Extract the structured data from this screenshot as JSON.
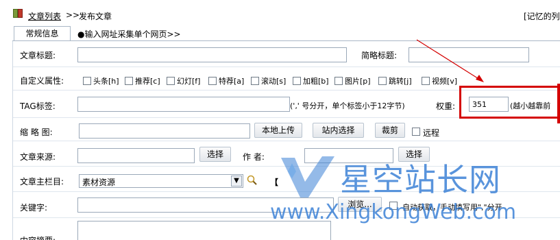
{
  "header": {
    "breadcrumb_link": "文章列表",
    "breadcrumb_sep": ">>",
    "breadcrumb_current": "发布文章",
    "remember": "[记忆的列"
  },
  "tabs": {
    "active": "常规信息",
    "other": "●输入网址采集单个网页>>"
  },
  "form": {
    "title_label": "文章标题:",
    "short_title_label": "简略标题:",
    "custom_attr_label": "自定义属性:",
    "attributes": [
      "头条[h]",
      "推荐[c]",
      "幻灯[f]",
      "特荐[a]",
      "滚动[s]",
      "加粗[b]",
      "图片[p]",
      "跳转[j]",
      "视频[v]"
    ],
    "tag_label": "TAG标签:",
    "tag_hint": "(',' 号分开，单个标签小于12字节)",
    "weight_label": "权重:",
    "weight_value": "351",
    "weight_hint": "(越小越靠前",
    "thumb_label": "缩 略 图:",
    "upload_button": "本地上传",
    "site_select_button": "站内选择",
    "crop_button": "裁剪",
    "remote_label": "远程",
    "source_label": "文章来源:",
    "select_button": "选择",
    "author_label": "作  者:",
    "author_select_button": "选择",
    "column_label": "文章主栏目:",
    "column_value": "素材资源",
    "column_extra": "【",
    "keywords_label": "关键字:",
    "browse_button": "浏览...",
    "auto_fetch_label": "自动获取，手动填写用\",\"分开",
    "summary_label": "内容摘要:"
  },
  "watermark": {
    "cn": "星空站长网",
    "en": "www.XingkongWeb.com"
  },
  "colors": {
    "annotation_red": "#d40000",
    "watermark_blue": "#3d82d6"
  }
}
